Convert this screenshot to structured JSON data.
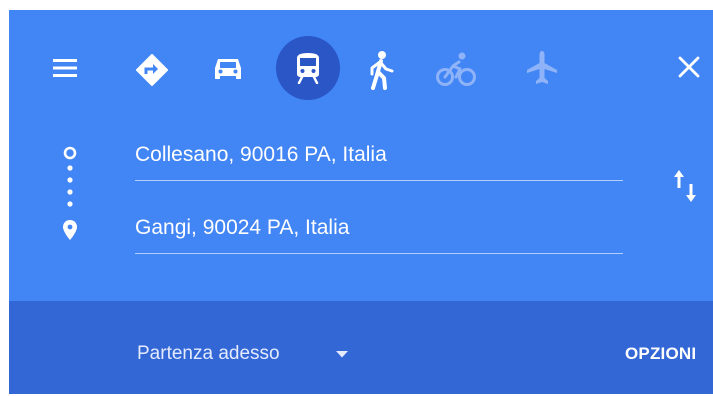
{
  "travel_modes": [
    {
      "name": "best-route",
      "icon": "directions-diamond-icon",
      "selected": false
    },
    {
      "name": "driving",
      "icon": "car-icon",
      "selected": false
    },
    {
      "name": "transit",
      "icon": "train-icon",
      "selected": true
    },
    {
      "name": "walking",
      "icon": "walking-icon",
      "selected": false
    },
    {
      "name": "cycling",
      "icon": "bicycle-icon",
      "selected": false
    },
    {
      "name": "flights",
      "icon": "airplane-icon",
      "selected": false
    }
  ],
  "origin": {
    "value": "Collesano, 90016 PA, Italia"
  },
  "destination": {
    "value": "Gangi, 90024 PA, Italia"
  },
  "departure": {
    "label": "Partenza adesso"
  },
  "options": {
    "label": "OPZIONI"
  },
  "colors": {
    "header": "#4285f4",
    "subbar": "#3367d6",
    "selected_mode": "#2a56c6",
    "text": "#ffffff",
    "dimmed_icon": "#8fb3f8"
  }
}
